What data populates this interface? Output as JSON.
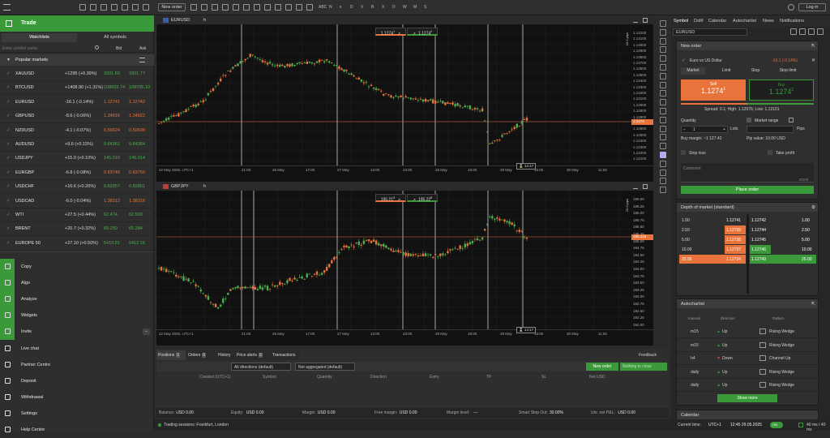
{
  "topbar": {
    "new_order": "New order",
    "login": "Log in",
    "icon_labels": [
      "ABC",
      "N",
      "x",
      "D",
      "V",
      "B",
      "X",
      "D",
      "W",
      "M",
      "S"
    ]
  },
  "sidebar": {
    "title": "Trade",
    "tab_watchlists": "Watchlists",
    "tab_all": "All symbols",
    "search_placeholder": "Enter symbol name",
    "col_bid": "Bid",
    "col_ask": "Ask",
    "group": "Popular markets",
    "rows": [
      {
        "sym": "XAUUSD",
        "chg": "+1295 (+0.39%)",
        "bid": "3301.69",
        "ask": "3301.77",
        "dir": "up"
      },
      {
        "sym": "BTCUSD",
        "chg": "+1408.90 (+1.31%)",
        "bid": "108693.74",
        "ask": "108705.10",
        "dir": "up"
      },
      {
        "sym": "EURUSD",
        "chg": "-16.1 (-0.14%)",
        "bid": "1.12741",
        "ask": "1.12742",
        "dir": "down"
      },
      {
        "sym": "GBPUSD",
        "chg": "-8.6 (-0.06%)",
        "bid": "1.34816",
        "ask": "1.34822",
        "dir": "down"
      },
      {
        "sym": "NZDUSD",
        "chg": "-4.1 (-0.07%)",
        "bid": "0.59624",
        "ask": "0.59630",
        "dir": "down"
      },
      {
        "sym": "AUDUSD",
        "chg": "+9.6 (+0.15%)",
        "bid": "0.64361",
        "ask": "0.64364",
        "dir": "up"
      },
      {
        "sym": "USDJPY",
        "chg": "+15.0 (+0.10%)",
        "bid": "145.010",
        "ask": "145.014",
        "dir": "up"
      },
      {
        "sym": "EURGBP",
        "chg": "-6.8 (-0.08%)",
        "bid": "0.83748",
        "ask": "0.83750",
        "dir": "down"
      },
      {
        "sym": "USDCHF",
        "chg": "+16.6 (+0.20%)",
        "bid": "0.82857",
        "ask": "0.82861",
        "dir": "up"
      },
      {
        "sym": "USDCAD",
        "chg": "-6.0 (-0.04%)",
        "bid": "1.38312",
        "ask": "1.38316",
        "dir": "down"
      },
      {
        "sym": "WTI",
        "chg": "+27.5 (+0.44%)",
        "bid": "62.474",
        "ask": "62.509",
        "dir": "up"
      },
      {
        "sym": "BRENT",
        "chg": "+20.7 (+0.32%)",
        "bid": "65.250",
        "ask": "65.284",
        "dir": "up"
      },
      {
        "sym": "EUROPE 50",
        "chg": "+27.10 (+0.50%)",
        "bid": "5410.81",
        "ask": "5412.16",
        "dir": "up"
      }
    ],
    "menu": [
      {
        "label": "Copy",
        "icon": "copy-icon"
      },
      {
        "label": "Algo",
        "icon": "algo-icon"
      },
      {
        "label": "Analyze",
        "icon": "analyze-icon"
      },
      {
        "label": "Widgets",
        "icon": "widgets-icon"
      },
      {
        "label": "Invite",
        "icon": "invite-icon"
      },
      {
        "label": "Live chat",
        "icon": "chat-icon"
      },
      {
        "label": "Partner Centre",
        "icon": "partner-icon"
      },
      {
        "label": "Deposit",
        "icon": "deposit-icon"
      },
      {
        "label": "Withdrawal",
        "icon": "withdrawal-icon"
      },
      {
        "label": "Settings",
        "icon": "gear-icon"
      },
      {
        "label": "Help Centre",
        "icon": "help-icon"
      }
    ]
  },
  "chart1": {
    "symbol": "EURUSD",
    "tf": "h",
    "sell": "1.1274",
    "sell_sup": "1",
    "buy": "1.1274",
    "buy_sup": "2",
    "last": "1.1274",
    "pips": "10.2 pips",
    "prices": [
      "1.14200",
      "1.14100",
      "1.14000",
      "1.13900",
      "1.13800",
      "1.13700",
      "1.13600",
      "1.13500",
      "1.13400",
      "1.13300",
      "1.13200",
      "1.13100",
      "1.13000",
      "1.12900",
      "1.12800",
      "1.12700",
      "1.12600",
      "1.12500",
      "1.12400",
      "1.12300",
      "1.12200",
      "1.12100"
    ],
    "times": [
      "22 May 2025, UTC+1",
      "21:00",
      "26 May",
      "17:00",
      "27 May",
      "13:00",
      "23:00",
      "28 May",
      "19:00",
      "29 May",
      "15:00",
      "30 May",
      "11:00"
    ],
    "cursor": "14:17"
  },
  "chart2": {
    "symbol": "GBPJPY",
    "tf": "h",
    "sell": "195.21",
    "sell_sup": "8",
    "buy": "195.22",
    "buy_sup": "8",
    "last": "195.218",
    "pips": "10.0 pips",
    "prices": [
      "196.50",
      "196.25",
      "196.00",
      "195.75",
      "195.50",
      "195.25",
      "195.00",
      "194.75",
      "194.50",
      "194.25",
      "194.00",
      "193.75",
      "193.50",
      "193.25",
      "193.00",
      "192.75",
      "192.50",
      "192.25",
      "192.00"
    ],
    "times": [
      "22 May 2025, UTC+1",
      "21:00",
      "26 May",
      "17:00",
      "27 May",
      "13:00",
      "23:00",
      "28 May",
      "19:00",
      "29 May",
      "15:00",
      "30 May",
      "11:00"
    ],
    "cursor": "14:17"
  },
  "bottom": {
    "tabs": [
      {
        "label": "Positions",
        "count": "0"
      },
      {
        "label": "Orders",
        "count": "0"
      },
      {
        "label": "History"
      },
      {
        "label": "Price alerts",
        "count": "0"
      },
      {
        "label": "Transactions"
      }
    ],
    "feedback": "Feedback",
    "dir_filter": "All directions (default)",
    "agg_filter": "Not aggregated (default)",
    "new_order": "New order",
    "nothing": "Nothing to close",
    "cols": [
      "Created (UTC+1)",
      "Symbol",
      "Quantity",
      "Direction",
      "Entry",
      "TP",
      "SL",
      "Net USD"
    ],
    "balance": [
      {
        "k": "Balance:",
        "v": "USD 0.00"
      },
      {
        "k": "Equity:",
        "v": "USD 0.00"
      },
      {
        "k": "Margin:",
        "v": "USD 0.00"
      },
      {
        "k": "Free margin:",
        "v": "USD 0.00"
      },
      {
        "k": "Margin level:",
        "v": "—"
      },
      {
        "k": "Smart Stop Out:",
        "v": "30.00%"
      },
      {
        "k": "Unr. net P&L:",
        "v": "USD 0.00"
      }
    ]
  },
  "status": {
    "sessions": "Trading sessions: Frankfurt, London",
    "time_label": "Current time:",
    "tz": "UTC+1",
    "time": "12:45 29.05.2025",
    "on": "ON",
    "latency": "40 ms / 40 ms"
  },
  "right": {
    "tabs": [
      "Symbol",
      "DoM",
      "Calendar",
      "Autochartist",
      "News",
      "Notifications"
    ],
    "symbol": "EURUSD",
    "neworder": {
      "title": "New order",
      "instrument": "Euro vs US Dollar",
      "chg": "-16.1 (-0.14%)",
      "types": [
        "Market",
        "Limit",
        "Stop",
        "Stop-limit"
      ],
      "sell_label": "Sell",
      "sell_price": "1.1274",
      "sell_sup": "1",
      "buy_label": "Buy",
      "buy_price": "1.1274",
      "buy_sup": "2",
      "spread": "Spread: 0.1; High: 1.12976; Low: 1.12101",
      "qty_label": "Quantity",
      "qty": "1",
      "lots": "Lots",
      "range": "Market range",
      "pips": "Pips",
      "buy_margin": "Buy margin: ~1 127.42",
      "pip_value": "Pip value: 10.00 USD",
      "stop_loss": "Stop loss",
      "take_profit": "Take profit",
      "comment": "Comment",
      "counter": "0/100",
      "place": "Place order"
    },
    "dom": {
      "title": "Depth of market (standard)",
      "sell": [
        {
          "vol": "1.00",
          "price": "1.12741"
        },
        {
          "vol": "2.50",
          "price": "1.12739"
        },
        {
          "vol": "5.00",
          "price": "1.12738"
        },
        {
          "vol": "10.00",
          "price": "1.12737"
        },
        {
          "vol": "25.00",
          "price": "1.12734"
        }
      ],
      "buy": [
        {
          "price": "1.12742",
          "vol": "1.00"
        },
        {
          "price": "1.12744",
          "vol": "2.50"
        },
        {
          "price": "1.12745",
          "vol": "5.00"
        },
        {
          "price": "1.12746",
          "vol": "10.00"
        },
        {
          "price": "1.12749",
          "vol": "25.00"
        }
      ]
    },
    "ac": {
      "title": "Autochartist",
      "cols": [
        "Interval",
        "Direction",
        "Pattern"
      ],
      "rows": [
        {
          "i": "m15",
          "d": "Up",
          "p": "Rising Wedge",
          "up": true
        },
        {
          "i": "m15",
          "d": "Up",
          "p": "Rising Wedge",
          "up": true
        },
        {
          "i": "h4",
          "d": "Down",
          "p": "Channel Up",
          "up": false
        },
        {
          "i": "daily",
          "d": "Up",
          "p": "Rising Wedge",
          "up": true
        },
        {
          "i": "daily",
          "d": "Up",
          "p": "Rising Wedge",
          "up": true
        }
      ],
      "more": "Show more"
    },
    "calendar": "Calendar"
  },
  "colors": {
    "green": "#3a9a3a",
    "orange": "#e8743b"
  }
}
